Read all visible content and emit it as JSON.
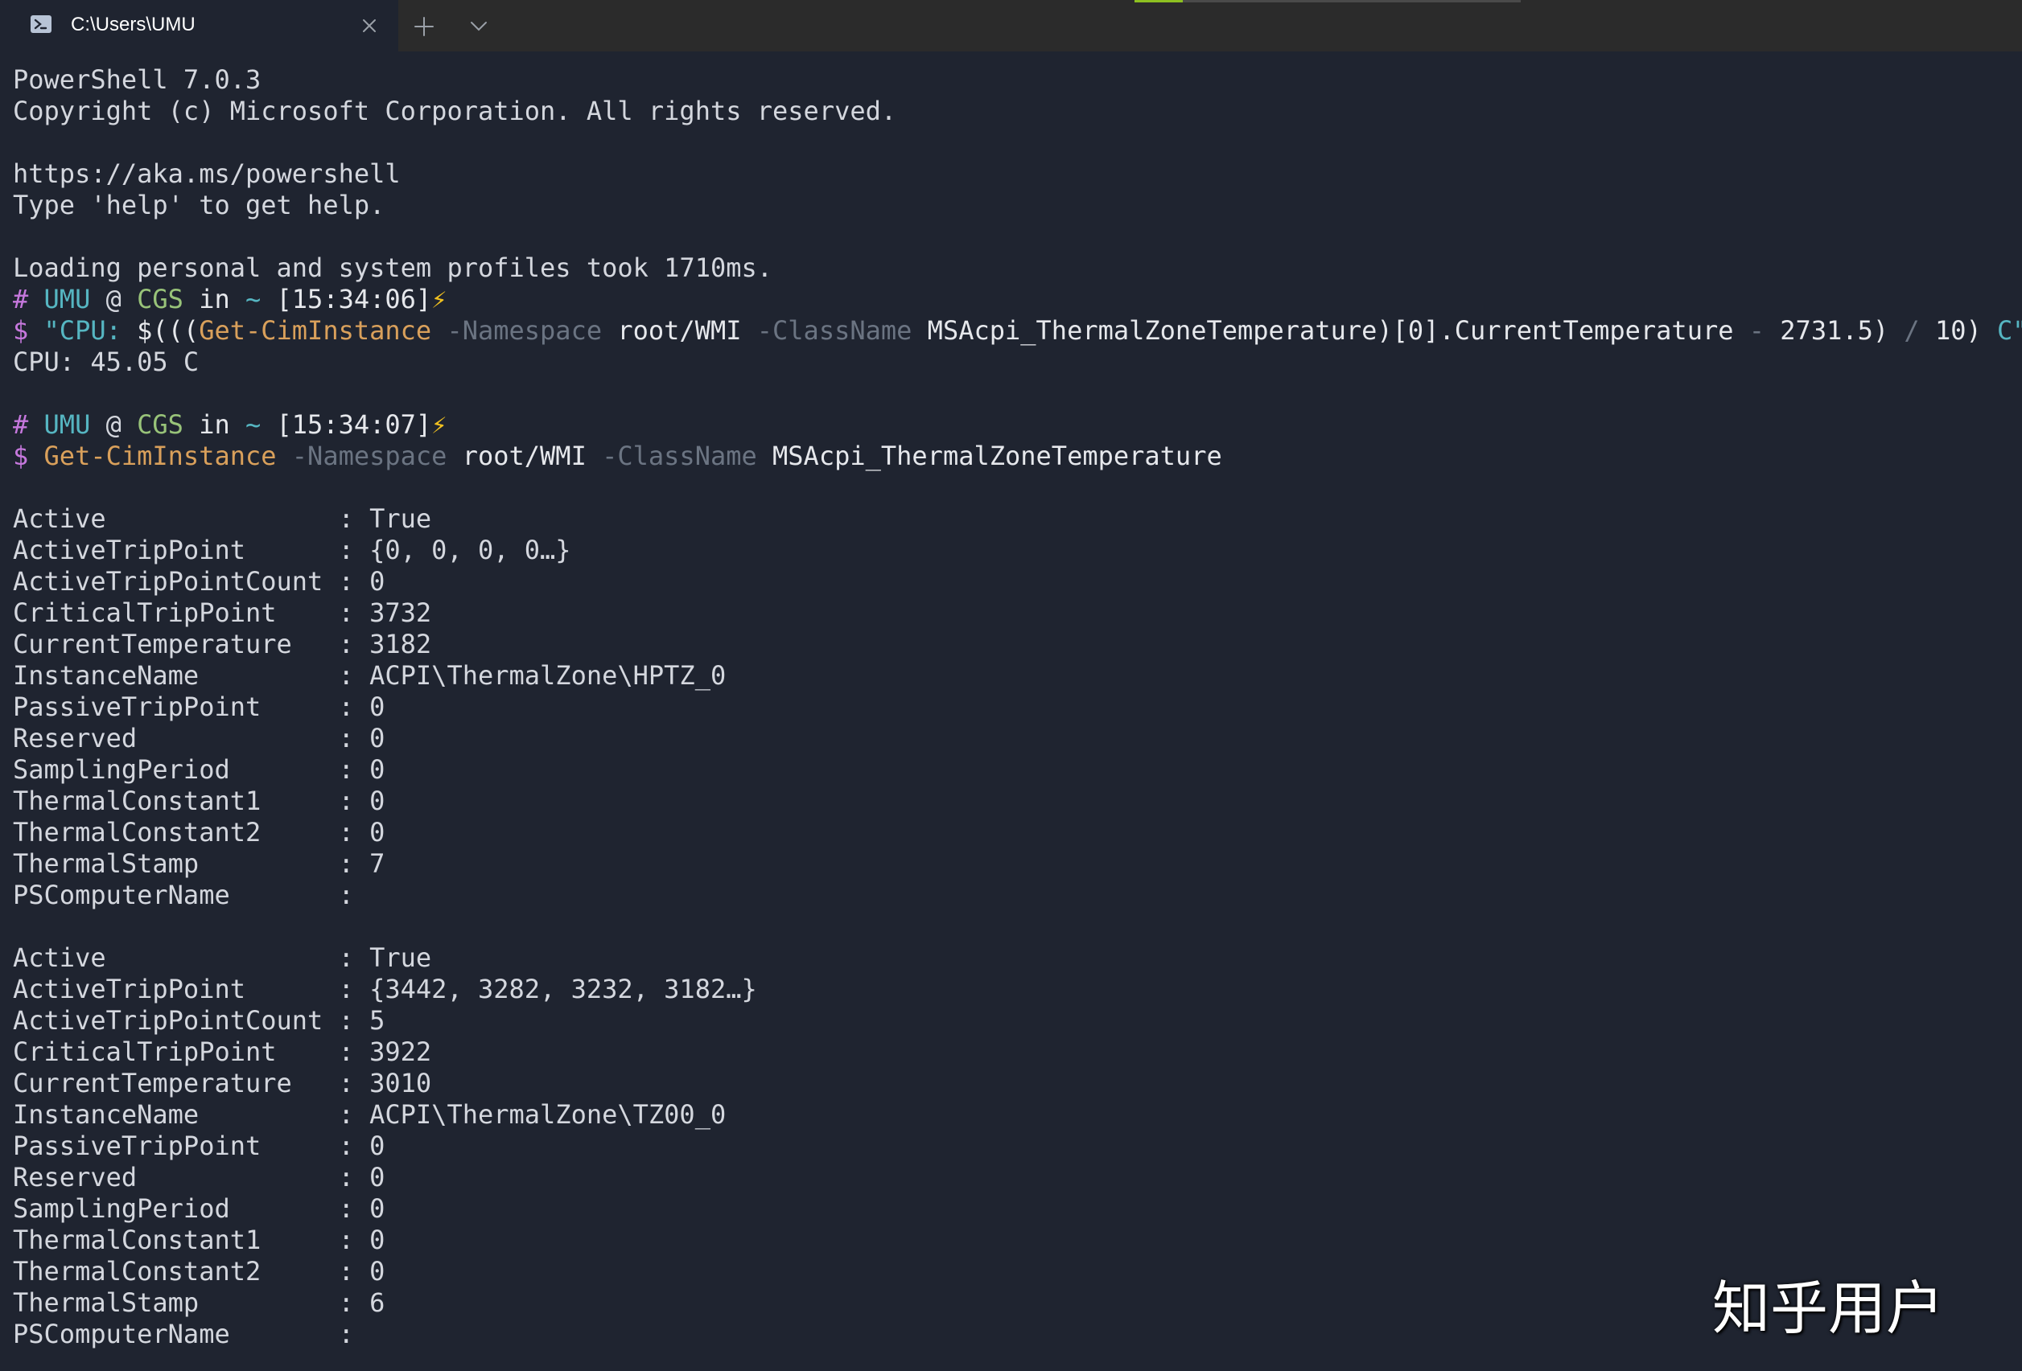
{
  "window": {
    "tab_title": "C:\\Users\\UMU",
    "icons": {
      "tab": "powershell-icon",
      "close": "close-icon",
      "new_tab": "plus-icon",
      "dropdown": "chevron-down-icon"
    },
    "accent_progress": {
      "color": "#8dc021",
      "fraction": 0.125
    }
  },
  "terminal": {
    "colors": {
      "background": "#1f2430",
      "foreground": "#d4d7de",
      "prompt_symbol": "#c678dd",
      "user": "#56b6c2",
      "host": "#98c379",
      "command": "#d9a05b",
      "parameter": "#6b7482"
    },
    "banner": {
      "version": "PowerShell 7.0.3",
      "copyright": "Copyright (c) Microsoft Corporation. All rights reserved.",
      "url": "https://aka.ms/powershell",
      "help": "Type 'help' to get help.",
      "loading": "Loading personal and system profiles took 1710ms."
    },
    "prompt1": {
      "hash": "#",
      "user": "UMU",
      "at": "@",
      "host": "CGS",
      "in": "in",
      "dir": "~",
      "time": "[15:34:06]",
      "bolt": "⚡"
    },
    "cmd1": {
      "dollar": "$",
      "str_open": "\"CPU: ",
      "subexpr_open": "$(((",
      "cmdlet": "Get-CimInstance",
      "p1": "-Namespace",
      "v1": "root/WMI",
      "p2": "-ClassName",
      "v2": "MSAcpi_ThermalZoneTemperature)[0].",
      "prop": "CurrentTemperature",
      "op_minus": "-",
      "num1": "2731.5",
      "paren_close": ")",
      "op_div": "/",
      "num2": "10",
      "paren_close2": ")",
      "str_close": "C\""
    },
    "output1": "CPU: 45.05 C",
    "prompt2": {
      "hash": "#",
      "user": "UMU",
      "at": "@",
      "host": "CGS",
      "in": "in",
      "dir": "~",
      "time": "[15:34:07]",
      "bolt": "⚡"
    },
    "cmd2": {
      "dollar": "$",
      "cmdlet": "Get-CimInstance",
      "p1": "-Namespace",
      "v1": "root/WMI",
      "p2": "-ClassName",
      "v2": "MSAcpi_ThermalZoneTemperature"
    },
    "instances": [
      {
        "rows": [
          "Active               : True",
          "ActiveTripPoint      : {0, 0, 0, 0…}",
          "ActiveTripPointCount : 0",
          "CriticalTripPoint    : 3732",
          "CurrentTemperature   : 3182",
          "InstanceName         : ACPI\\ThermalZone\\HPTZ_0",
          "PassiveTripPoint     : 0",
          "Reserved             : 0",
          "SamplingPeriod       : 0",
          "ThermalConstant1     : 0",
          "ThermalConstant2     : 0",
          "ThermalStamp         : 7",
          "PSComputerName       :"
        ]
      },
      {
        "rows": [
          "Active               : True",
          "ActiveTripPoint      : {3442, 3282, 3232, 3182…}",
          "ActiveTripPointCount : 5",
          "CriticalTripPoint    : 3922",
          "CurrentTemperature   : 3010",
          "InstanceName         : ACPI\\ThermalZone\\TZ00_0",
          "PassiveTripPoint     : 0",
          "Reserved             : 0",
          "SamplingPeriod       : 0",
          "ThermalConstant1     : 0",
          "ThermalConstant2     : 0",
          "ThermalStamp         : 6",
          "PSComputerName       :"
        ]
      }
    ]
  },
  "watermark": "知乎用户"
}
